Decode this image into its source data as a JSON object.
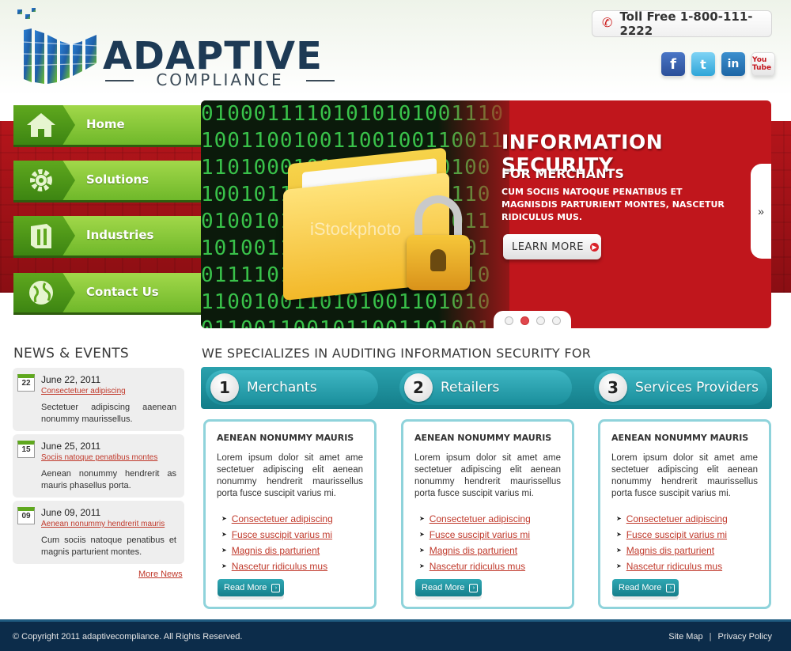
{
  "header": {
    "logo_word": "ADAPTIVE",
    "logo_sub": "COMPLIANCE",
    "phone": "Toll Free 1-800-111-2222",
    "socials": [
      {
        "name": "facebook",
        "glyph": "f"
      },
      {
        "name": "twitter",
        "glyph": "t"
      },
      {
        "name": "linkedin",
        "glyph": "in"
      },
      {
        "name": "youtube",
        "glyph": "You Tube"
      }
    ]
  },
  "nav": {
    "items": [
      {
        "label": "Home",
        "icon": "home-icon"
      },
      {
        "label": "Solutions",
        "icon": "gear-icon"
      },
      {
        "label": "Industries",
        "icon": "building-icon"
      },
      {
        "label": "Contact Us",
        "icon": "globe-icon"
      }
    ]
  },
  "slide": {
    "title": "INFORMATION SECURITY",
    "subtitle": "FOR MERCHANTS",
    "description": "CUM SOCIIS NATOQUE PENATIBUS ET MAGNISDIS PARTURIENT MONTES, NASCETUR RIDICULUS MUS.",
    "button": "LEARN MORE",
    "watermark": "iStockphoto",
    "binary_rows": [
      "01000111101010101001110",
      "10011001001100100110011",
      "1101000101110010110100",
      "1001011101100010110110",
      "0100101001101001010011",
      "1010011010010011010101",
      "0111101101001010010110",
      "1100100110101001101010",
      "0110011001011001101001"
    ],
    "next_arrow": "»",
    "active_dot": 1,
    "dot_count": 4
  },
  "news": {
    "title": "NEWS & EVENTS",
    "items": [
      {
        "day": "22",
        "date": "June 22, 2011",
        "link": "Consectetuer adipiscing",
        "text": "Sectetuer adipiscing aaenean nonummy maurissellus."
      },
      {
        "day": "15",
        "date": "June 25, 2011",
        "link": "Sociis natoque penatibus montes",
        "text": "Aenean nonummy hendrerit as mauris phasellus porta."
      },
      {
        "day": "09",
        "date": "June 09, 2011",
        "link": "Aenean nonummy hendrerit mauris",
        "text": "Cum sociis natoque penatibus et magnis parturient montes."
      }
    ],
    "more": "More News"
  },
  "main": {
    "title": "WE SPECIALIZES IN AUDITING INFORMATION SECURITY FOR",
    "segments": [
      {
        "num": "1",
        "label": "Merchants"
      },
      {
        "num": "2",
        "label": "Retailers"
      },
      {
        "num": "3",
        "label": "Services Providers"
      }
    ],
    "cards": [
      {
        "head": "AENEAN NONUMMY MAURIS",
        "text": "Lorem ipsum dolor sit amet ame sectetuer adipiscing elit aenean nonummy hendrerit maurissellus porta fusce suscipit varius mi.",
        "links": [
          "Consectetuer adipiscing",
          "Fusce suscipit varius mi",
          "Magnis dis parturient",
          "Nascetur ridiculus mus"
        ],
        "button": "Read More"
      },
      {
        "head": "AENEAN NONUMMY MAURIS",
        "text": "Lorem ipsum dolor sit amet ame sectetuer adipiscing elit aenean nonummy hendrerit maurissellus porta fusce suscipit varius mi.",
        "links": [
          "Consectetuer adipiscing",
          "Fusce suscipit varius mi",
          "Magnis dis parturient",
          "Nascetur ridiculus mus"
        ],
        "button": "Read More"
      },
      {
        "head": "AENEAN NONUMMY MAURIS",
        "text": "Lorem ipsum dolor sit amet ame sectetuer adipiscing elit aenean nonummy hendrerit maurissellus porta fusce suscipit varius mi.",
        "links": [
          "Consectetuer adipiscing",
          "Fusce suscipit varius mi",
          "Magnis dis parturient",
          "Nascetur ridiculus mus"
        ],
        "button": "Read More"
      }
    ]
  },
  "footer": {
    "copyright": "© Copyright 2011 adaptivecompliance. All Rights Reserved.",
    "sitemap": "Site Map",
    "separator": "|",
    "privacy": "Privacy Policy"
  },
  "colors": {
    "brand_green": "#6fb82a",
    "banner_red": "#c0161c",
    "teal": "#1a8e9b",
    "footer_navy": "#0c2c4a",
    "link_red": "#c0392b"
  }
}
